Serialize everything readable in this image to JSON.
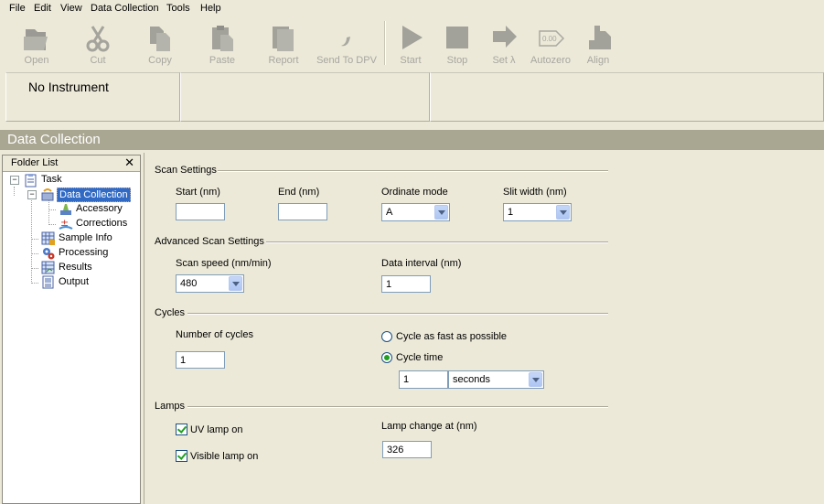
{
  "menu": [
    "File",
    "Edit",
    "View",
    "Data Collection",
    "Tools",
    "Help"
  ],
  "toolbar": {
    "open": "Open",
    "cut": "Cut",
    "copy": "Copy",
    "paste": "Paste",
    "report": "Report",
    "send_to_dpv": "Send To DPV",
    "start": "Start",
    "stop": "Stop",
    "set_lambda": "Set λ",
    "autozero": "Autozero",
    "align": "Align",
    "autozero_icon_text": "0.00"
  },
  "status": {
    "instrument": "No Instrument"
  },
  "section_title": "Data Collection",
  "folder_list": {
    "title": "Folder List",
    "close": "✕",
    "items": [
      "Task",
      "Data Collection",
      "Accessory",
      "Corrections",
      "Sample Info",
      "Processing",
      "Results",
      "Output"
    ]
  },
  "scan_settings": {
    "title": "Scan Settings",
    "start_label": "Start (nm)",
    "start_value": "",
    "end_label": "End (nm)",
    "end_value": "",
    "ordinate_label": "Ordinate mode",
    "ordinate_value": "A",
    "slit_label": "Slit width (nm)",
    "slit_value": "1"
  },
  "advanced": {
    "title": "Advanced Scan Settings",
    "speed_label": "Scan speed (nm/min)",
    "speed_value": "480",
    "interval_label": "Data interval (nm)",
    "interval_value": "1"
  },
  "cycles": {
    "title": "Cycles",
    "number_label": "Number of cycles",
    "number_value": "1",
    "fast_label": "Cycle as fast as possible",
    "time_label": "Cycle time",
    "time_value": "1",
    "time_unit": "seconds",
    "selected": "time"
  },
  "lamps": {
    "title": "Lamps",
    "uv_label": "UV lamp on",
    "uv_checked": true,
    "vis_label": "Visible lamp on",
    "vis_checked": true,
    "change_label": "Lamp change at (nm)",
    "change_value": "326"
  },
  "colors": {
    "section_bar": "#a9a692",
    "selection": "#316ac5",
    "background": "#ece9d8"
  }
}
